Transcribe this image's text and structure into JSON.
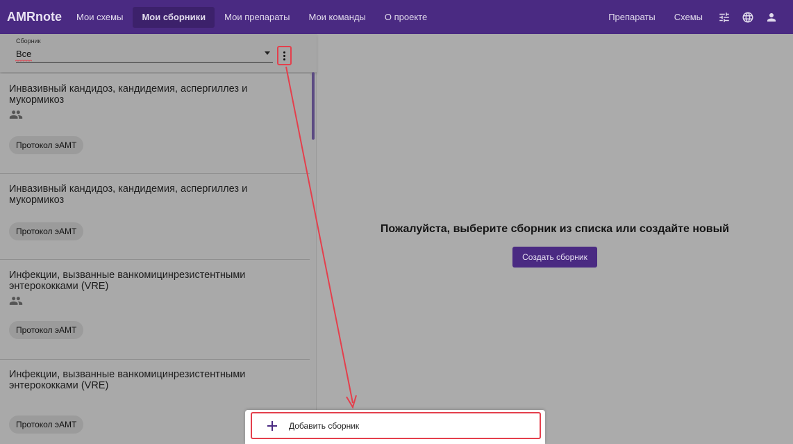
{
  "app": {
    "brand": "AMRnote"
  },
  "nav": {
    "items": [
      {
        "label": "Мои схемы"
      },
      {
        "label": "Мои сборники"
      },
      {
        "label": "Мои препараты"
      },
      {
        "label": "Мои команды"
      },
      {
        "label": "О проекте"
      }
    ],
    "active": "Мои сборники",
    "right_items": [
      {
        "label": "Препараты"
      },
      {
        "label": "Схемы"
      }
    ],
    "icons": [
      "tune-icon",
      "globe-icon",
      "account-icon"
    ]
  },
  "collection_selector": {
    "label": "Сборник",
    "value": "Все"
  },
  "cards": [
    {
      "title": "Инвазивный кандидоз, кандидемия, аспергиллез и мукормикоз",
      "shared": true,
      "chip": "Протокол эАМТ"
    },
    {
      "title": "Инвазивный кандидоз, кандидемия, аспергиллез и мукормикоз",
      "shared": false,
      "chip": "Протокол эАМТ"
    },
    {
      "title": "Инфекции, вызванные ванкомицинрезистентными энтерококками (VRE)",
      "shared": true,
      "chip": "Протокол эАМТ"
    },
    {
      "title": "Инфекции, вызванные ванкомицинрезистентными энтерококками (VRE)",
      "shared": false,
      "chip": "Протокол эАМТ"
    }
  ],
  "main": {
    "empty_message": "Пожалуйста, выберите сборник из списка или создайте новый",
    "create_button": "Создать сборник"
  },
  "popup_menu": {
    "items": [
      {
        "label": "Добавить сборник",
        "icon": "plus-icon"
      }
    ]
  },
  "colors": {
    "primary": "#4a2a82",
    "annotation": "#e43f4c"
  }
}
